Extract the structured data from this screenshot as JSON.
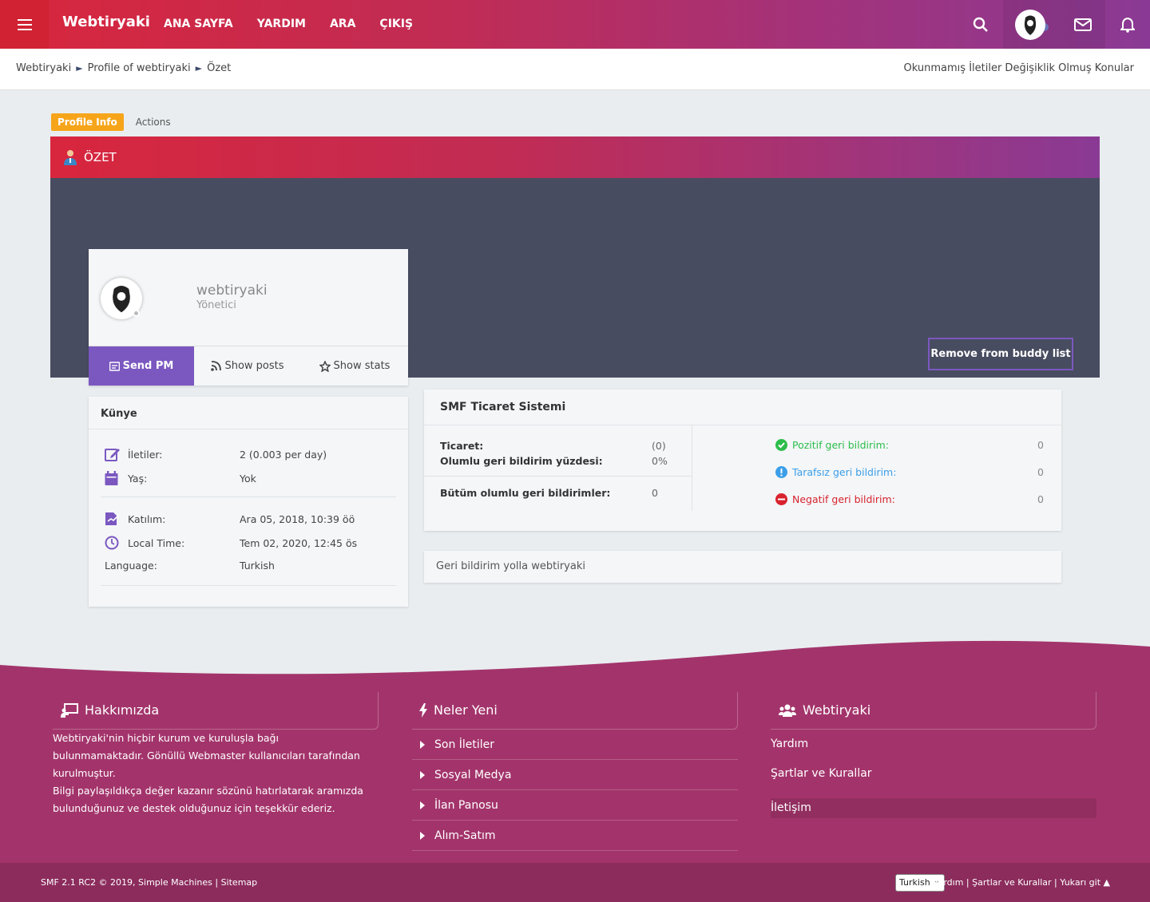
{
  "header": {
    "brand": "Webtiryaki",
    "nav": [
      "ANA SAYFA",
      "YARDIM",
      "ARA",
      "ÇIKIŞ"
    ]
  },
  "breadcrumb": {
    "items": [
      "Webtiryaki",
      "Profile of webtiryaki",
      "Özet"
    ],
    "right_links": "Okunmamış İletiler Değişiklik Olmuş Konular"
  },
  "tabs": {
    "active": "Profile Info",
    "other": "Actions"
  },
  "section_title": "ÖZET",
  "profile": {
    "username": "webtiryaki",
    "role": "Yönetici",
    "send_pm": "Send PM",
    "show_posts": "Show posts",
    "show_stats": "Show stats",
    "buddy_button": "Remove from buddy list"
  },
  "kunye": {
    "title": "Künye",
    "rows": [
      {
        "label": "İletiler:",
        "value": "2 (0.003 per day)"
      },
      {
        "label": "Yaş:",
        "value": "Yok"
      },
      {
        "label": "Katılım:",
        "value": "Ara 05, 2018, 10:39 öö"
      },
      {
        "label": "Local Time:",
        "value": "Tem 02, 2020, 12:45 ös"
      },
      {
        "label": "Language:",
        "value": "Turkish"
      }
    ]
  },
  "smf": {
    "title": "SMF Ticaret Sistemi",
    "ticaret_label": "Ticaret:",
    "ticaret_value": "(0)",
    "olumlu_label": "Olumlu geri bildirim yüzdesi:",
    "olumlu_value": "0%",
    "butum_label": "Bütüm olumlu geri bildirimler:",
    "butum_value": "0",
    "pozitif_label": "Pozitif geri bildirim:",
    "pozitif_value": "0",
    "tarafsiz_label": "Tarafsız geri bildirim:",
    "tarafsiz_value": "0",
    "negatif_label": "Negatif geri bildirim:",
    "negatif_value": "0",
    "colors": {
      "pozitif": "#2dbd4a",
      "tarafsiz": "#3b9ee8",
      "negatif": "#d8232e"
    }
  },
  "geri": "Geri bildirim yolla webtiryaki",
  "footer": {
    "about_title": "Hakkımızda",
    "about_p1": "Webtiryaki'nin hiçbir kurum ve kuruluşla bağı bulunmamaktadır. Gönüllü Webmaster kullanıcıları tarafından kurulmuştur.",
    "about_p2": "Bilgi paylaşıldıkça değer kazanır sözünü hatırlatarak aramızda bulunduğunuz ve destek olduğunuz için teşekkür ederiz.",
    "new_title": "Neler Yeni",
    "new_links": [
      "Son İletiler",
      "Sosyal Medya",
      "İlan Panosu",
      "Alım-Satım"
    ],
    "site_title": "Webtiryaki",
    "site_links": [
      "Yardım",
      "Şartlar ve Kurallar",
      "İletişim"
    ]
  },
  "bottom": {
    "left": "SMF 2.1 RC2 © 2019, Simple Machines | Sitemap",
    "lang": "Turkish",
    "right": "Yardım | Şartlar ve Kurallar | Yukarı git ▲"
  },
  "colors": {
    "accent": "#7b58c0",
    "brand_red": "#d8263d",
    "brand_purple": "#8a3a95",
    "footer": "#a3346b"
  }
}
